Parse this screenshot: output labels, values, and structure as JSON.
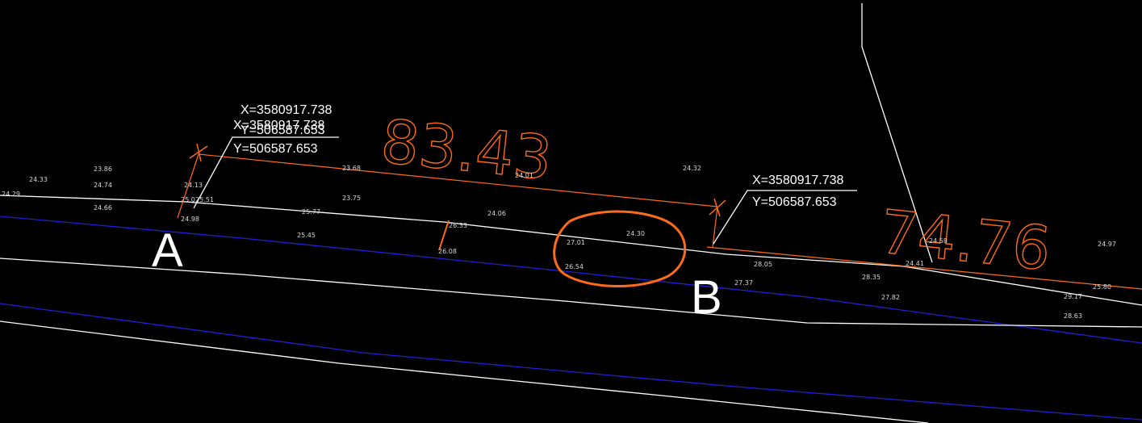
{
  "viewport": {
    "name": "cad-drawing-viewport"
  },
  "colors": {
    "background": "#000000",
    "road_edge": "#ffffff",
    "centerline": "#1f1fd6",
    "dimension": "#ff6a1a",
    "markup": "#ff6a1a",
    "elevation_text": "#d8d8d8"
  },
  "points": {
    "A": {
      "label": "A",
      "coordinates": [
        {
          "x": "X=3580917.738",
          "y": "Y=506587.653"
        },
        {
          "x": "X=3580917.738",
          "y": "Y=506587.653"
        }
      ]
    },
    "B": {
      "label": "B",
      "coordinates": [
        {
          "x": "X=3580917.738",
          "y": "Y=506587.653"
        }
      ]
    }
  },
  "dimensions": {
    "segment_ab": "83.43",
    "segment_b_next": "74.76"
  },
  "elevations": [
    "24.33",
    "23.86",
    "24.74",
    "24.66",
    "24.29",
    "24.13",
    "25.0",
    "25.51",
    "24.98",
    "23.68",
    "23.75",
    "25.77",
    "25.45",
    "26.33",
    "26.08",
    "24.06",
    "24.01",
    "27.01",
    "26.54",
    "24.30",
    "24.32",
    "28.05",
    "27.37",
    "28.35",
    "27.82",
    "24.58",
    "24.41",
    "24.97",
    "25.80",
    "29.17",
    "28.63"
  ],
  "markup": {
    "type": "circle-annotation",
    "description_icon": "hand-drawn-circle-icon"
  }
}
